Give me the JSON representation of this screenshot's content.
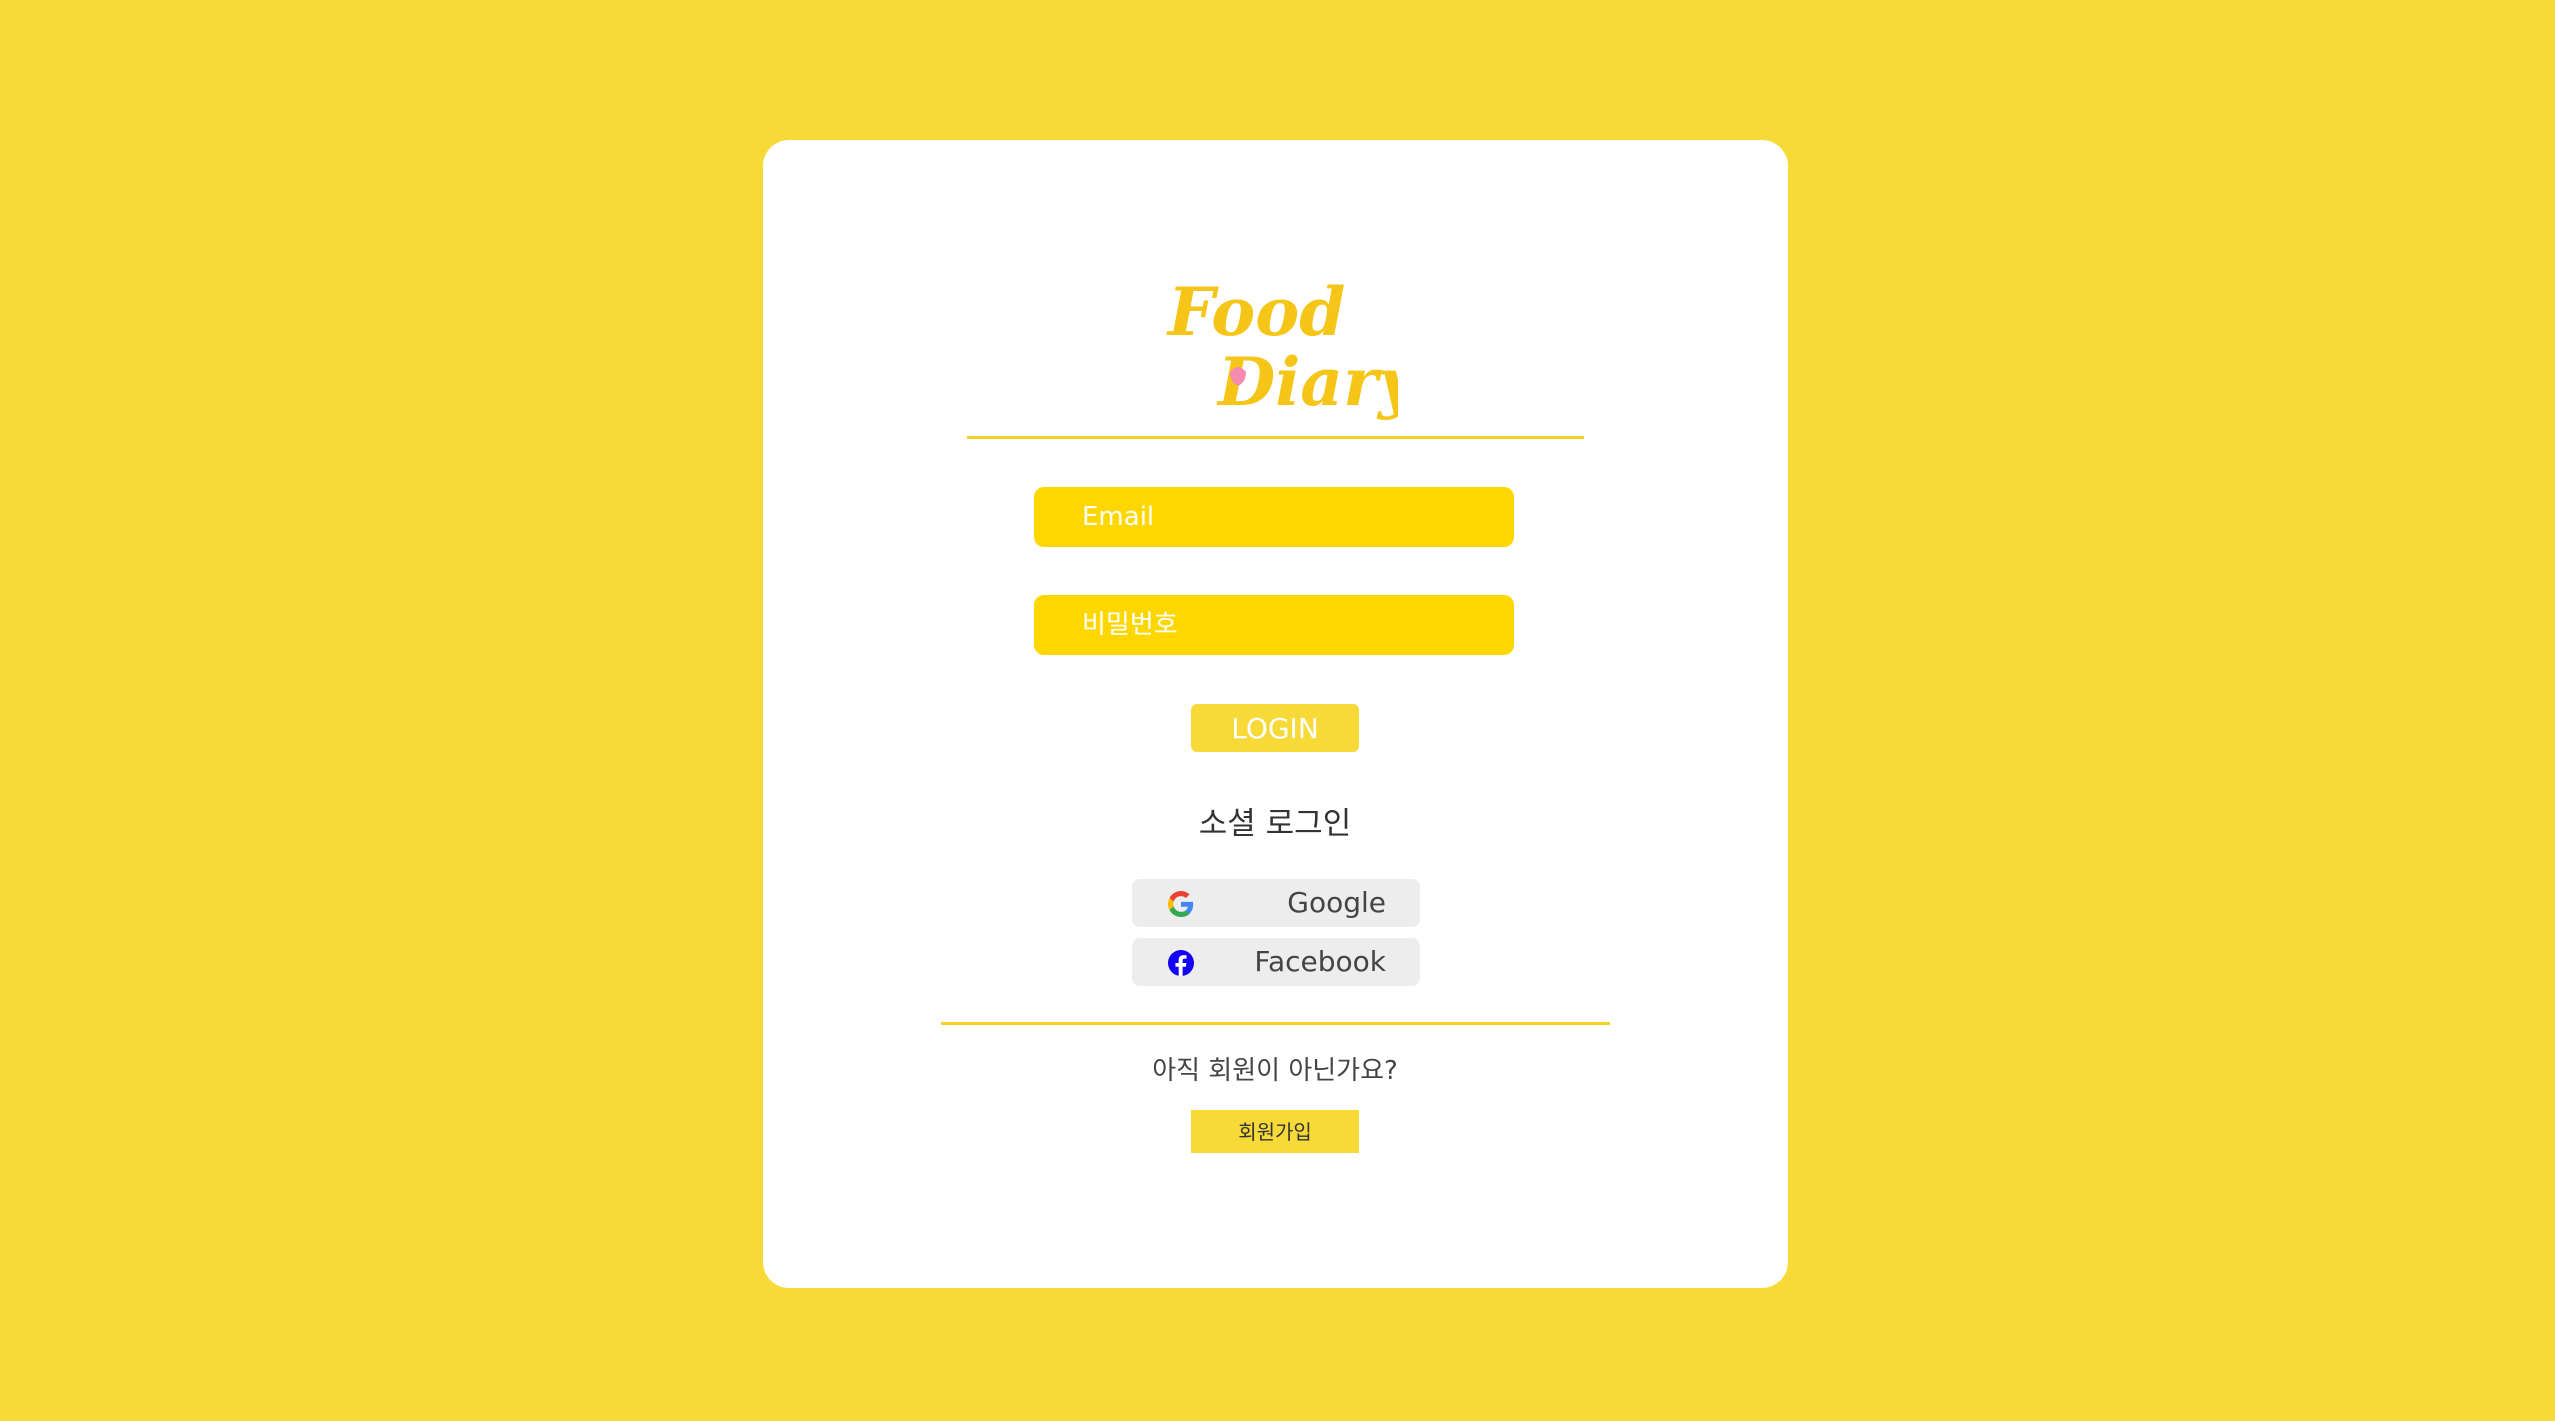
{
  "colors": {
    "background": "#F7DA38",
    "card": "#FFFFFF",
    "input_fill": "#FFD700",
    "accent": "#F5D126",
    "social_button": "#EDEDED",
    "logo_yellow": "#F5C518",
    "logo_pink": "#F58BB0"
  },
  "logo": {
    "line1": "Food",
    "line2": "Diary"
  },
  "form": {
    "email_placeholder": "Email",
    "password_placeholder": "비밀번호",
    "login_label": "LOGIN"
  },
  "social": {
    "heading": "소셜 로그인",
    "google_label": "Google",
    "google_icon": "google-g-icon",
    "facebook_label": "Facebook",
    "facebook_icon": "facebook-f-icon"
  },
  "signup": {
    "question": "아직 회원이 아닌가요?",
    "button_label": "회원가입"
  }
}
